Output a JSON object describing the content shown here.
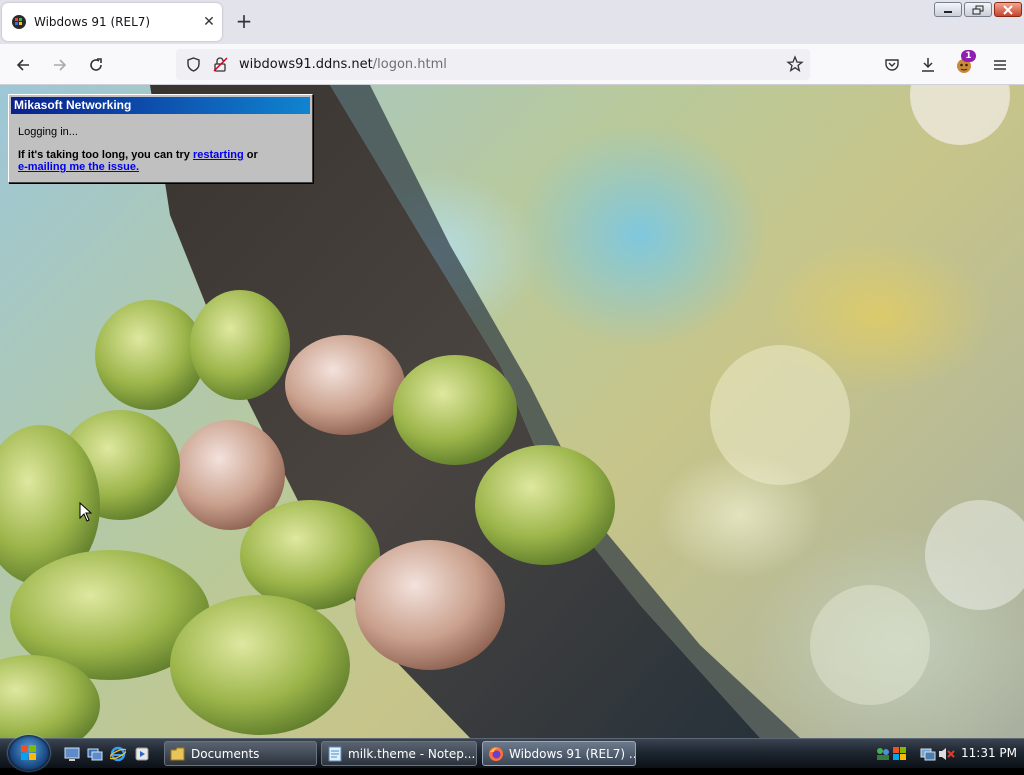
{
  "browser": {
    "tab": {
      "title": "Wibdows 91 (REL7)",
      "close_glyph": "✕"
    },
    "new_tab_glyph": "+",
    "address": {
      "host": "wibdows91.ddns.net",
      "path": "/logon.html"
    },
    "extension_badge": "1",
    "icons": [
      "back-icon",
      "forward-icon",
      "reload-icon",
      "shield-icon",
      "insecure-lock-icon",
      "bookmark-star-icon",
      "pocket-icon",
      "download-icon",
      "extension-icon",
      "menu-icon"
    ]
  },
  "dialog": {
    "title": "Mikasoft Networking",
    "status": "Logging in...",
    "msg_pre": "If it's taking too long, you can try ",
    "link_restart": "restarting",
    "msg_mid": " or",
    "link_email": "e-mailing me the issue."
  },
  "taskbar": {
    "buttons": [
      {
        "label": "Documents",
        "icon": "folder-icon"
      },
      {
        "label": "milk.theme - Notep...",
        "icon": "notepad-icon"
      },
      {
        "label": "Wibdows 91 (REL7) ...",
        "icon": "firefox-icon"
      }
    ],
    "clock": "11:31 PM"
  },
  "colors": {
    "dialog_title_start": "#0a1f8c",
    "dialog_title_end": "#1084d0",
    "link": "#0000ee",
    "badge": "#8f1fb0"
  }
}
